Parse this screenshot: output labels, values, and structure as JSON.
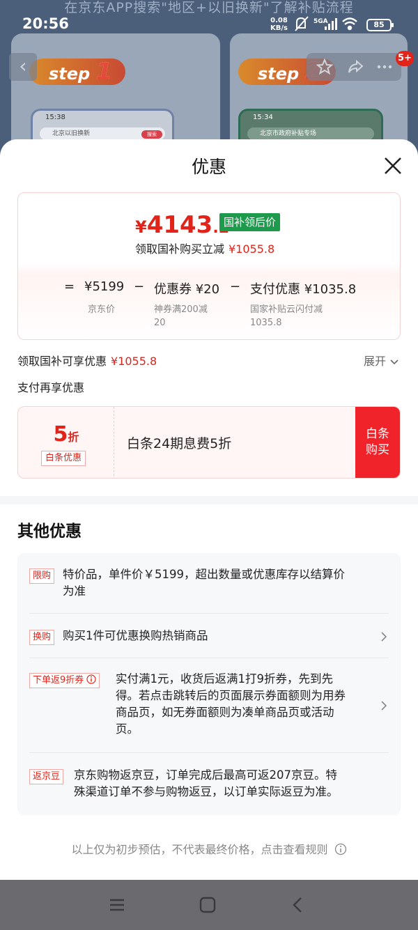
{
  "background": {
    "banner_text": "在京东APP搜索\"地区+以旧换新\"了解补贴流程",
    "step1_label": "step",
    "step1_num": "1",
    "step2_label": "step",
    "step2_num": "2",
    "phone1_time": "15:38",
    "phone1_search": "北京以旧换新",
    "phone1_btn": "搜索",
    "phone2_time": "15:34",
    "phone2_search": "北京市政府补贴专场",
    "badge_count": "5+"
  },
  "status_bar": {
    "time": "20:56",
    "net_speed": "0.08",
    "net_unit": "KB/s",
    "network": "5GA",
    "battery": "85"
  },
  "sheet": {
    "title": "优惠",
    "price": {
      "currency": "¥",
      "integer": "4143",
      "decimal": ".2",
      "tag": "国补领后价",
      "get_label": "领取国补购买立减",
      "get_amount": "¥1055.8"
    },
    "breakdown": {
      "eq": "=",
      "jd_price": "¥5199",
      "minus1": "−",
      "coupon": "优惠券 ¥20",
      "minus2": "−",
      "pay": "支付优惠 ¥1035.8",
      "jd_price_label": "京东价",
      "coupon_label_1": "神券满200减",
      "coupon_label_2": "20",
      "pay_label_1": "国家补贴云闪付减",
      "pay_label_2": "1035.8"
    },
    "gov_row_label": "领取国补可享优惠",
    "gov_row_amount": "¥1055.8",
    "expand_label": "展开",
    "pay_more_label": "支付再享优惠",
    "baitiao": {
      "discount_num": "5",
      "discount_unit": "折",
      "tag": "白条优惠",
      "text": "白条24期息费5折",
      "buy_line1": "白条",
      "buy_line2": "购买"
    },
    "other_title": "其他优惠",
    "other_items": [
      {
        "tag": "限购",
        "line1": "特价品，单件价￥5199，超出数量或优惠库存以结算价",
        "line2": "为准"
      },
      {
        "tag": "换购",
        "line1": "购买1件可优惠换购热销商品"
      },
      {
        "tag": "下单返9折券",
        "line1": "实付满1元，收货后返满1打9折券，先到先",
        "line2": "得。若点击跳转后的页面展示券面额则为用券",
        "line3": "商品页，如无券面额则为凑单商品页或活动",
        "line4": "页。"
      },
      {
        "tag": "返京豆",
        "line1": "京东购物返京豆，订单完成后最高可返207京豆。特",
        "line2": "殊渠道订单不参与购物返豆，以订单实际返豆为准。"
      }
    ],
    "footnote": "以上仅为初步预估，不代表最终价格，点击查看规则"
  },
  "colors": {
    "accent_red": "#e2231a",
    "gov_green": "#1d9a4b"
  },
  "icons": [
    "back-arrow-icon",
    "star-icon",
    "share-icon",
    "more-icon",
    "close-icon",
    "chevron-down-icon",
    "chevron-right-icon",
    "info-icon",
    "menu-icon",
    "home-icon",
    "back-nav-icon"
  ]
}
